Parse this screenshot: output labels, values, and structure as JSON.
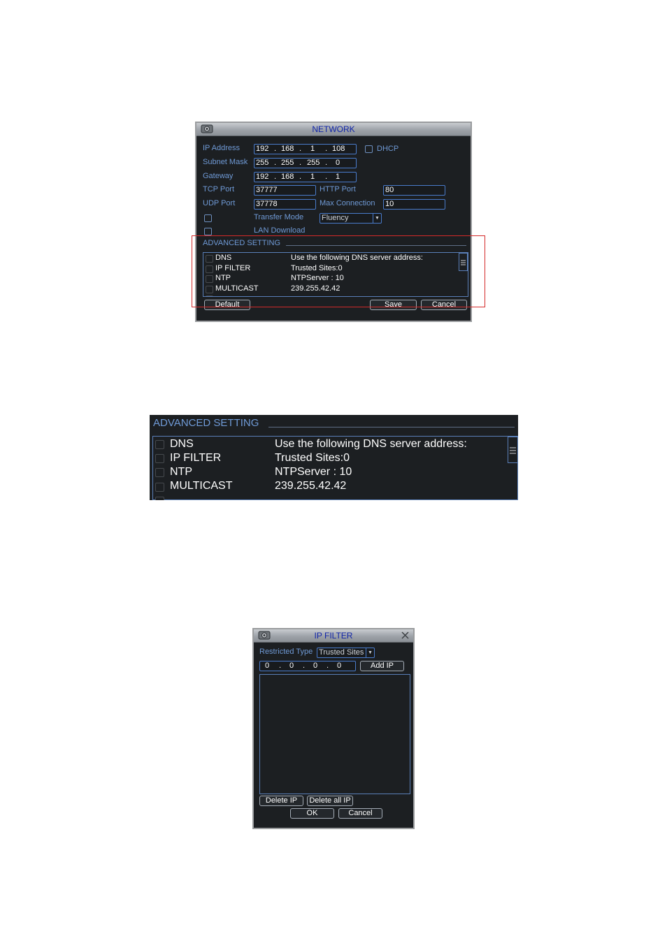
{
  "network": {
    "title": "NETWORK",
    "ip_address_label": "IP Address",
    "ip_address": [
      "192",
      "168",
      "1",
      "108"
    ],
    "dhcp_label": "DHCP",
    "subnet_mask_label": "Subnet Mask",
    "subnet_mask": [
      "255",
      "255",
      "255",
      "0"
    ],
    "gateway_label": "Gateway",
    "gateway": [
      "192",
      "168",
      "1",
      "1"
    ],
    "tcp_port_label": "TCP Port",
    "tcp_port": "37777",
    "http_port_label": "HTTP Port",
    "http_port": "80",
    "udp_port_label": "UDP Port",
    "udp_port": "37778",
    "max_connection_label": "Max Connection",
    "max_connection": "10",
    "transfer_mode_label": "Transfer Mode",
    "transfer_mode": "Fluency",
    "lan_download_label": "LAN Download",
    "advanced_label": "ADVANCED SETTING",
    "advanced_items": [
      {
        "name": "DNS",
        "value": "Use the following DNS server address:"
      },
      {
        "name": "IP FILTER",
        "value": "Trusted Sites:0"
      },
      {
        "name": "NTP",
        "value": "NTPServer : 10"
      },
      {
        "name": "MULTICAST",
        "value": "239.255.42.42"
      }
    ],
    "default_button": "Default",
    "save_button": "Save",
    "cancel_button": "Cancel"
  },
  "zoom": {
    "advanced_label": "ADVANCED SETTING",
    "items": [
      {
        "name": "DNS",
        "value": "Use the following DNS server address:"
      },
      {
        "name": "IP FILTER",
        "value": "Trusted Sites:0"
      },
      {
        "name": "NTP",
        "value": "NTPServer : 10"
      },
      {
        "name": "MULTICAST",
        "value": "239.255.42.42"
      }
    ]
  },
  "ipfilter": {
    "title": "IP FILTER",
    "restricted_type_label": "Restricted Type",
    "restricted_type": "Trusted Sites",
    "ip": [
      "0",
      "0",
      "0",
      "0"
    ],
    "add_ip_button": "Add IP",
    "delete_ip_button": "Delete IP",
    "delete_all_ip_button": "Delete all IP",
    "ok_button": "OK",
    "cancel_button": "Cancel"
  },
  "colors": {
    "panel_bg": "#1c1f22",
    "label_blue": "#6f9ad6",
    "title_blue": "#1024a8",
    "highlight_red": "#d42a2a"
  },
  "icons": [
    "dvr-logo-icon",
    "dropdown-arrow-icon",
    "close-icon",
    "scrollbar-grip-icon"
  ]
}
